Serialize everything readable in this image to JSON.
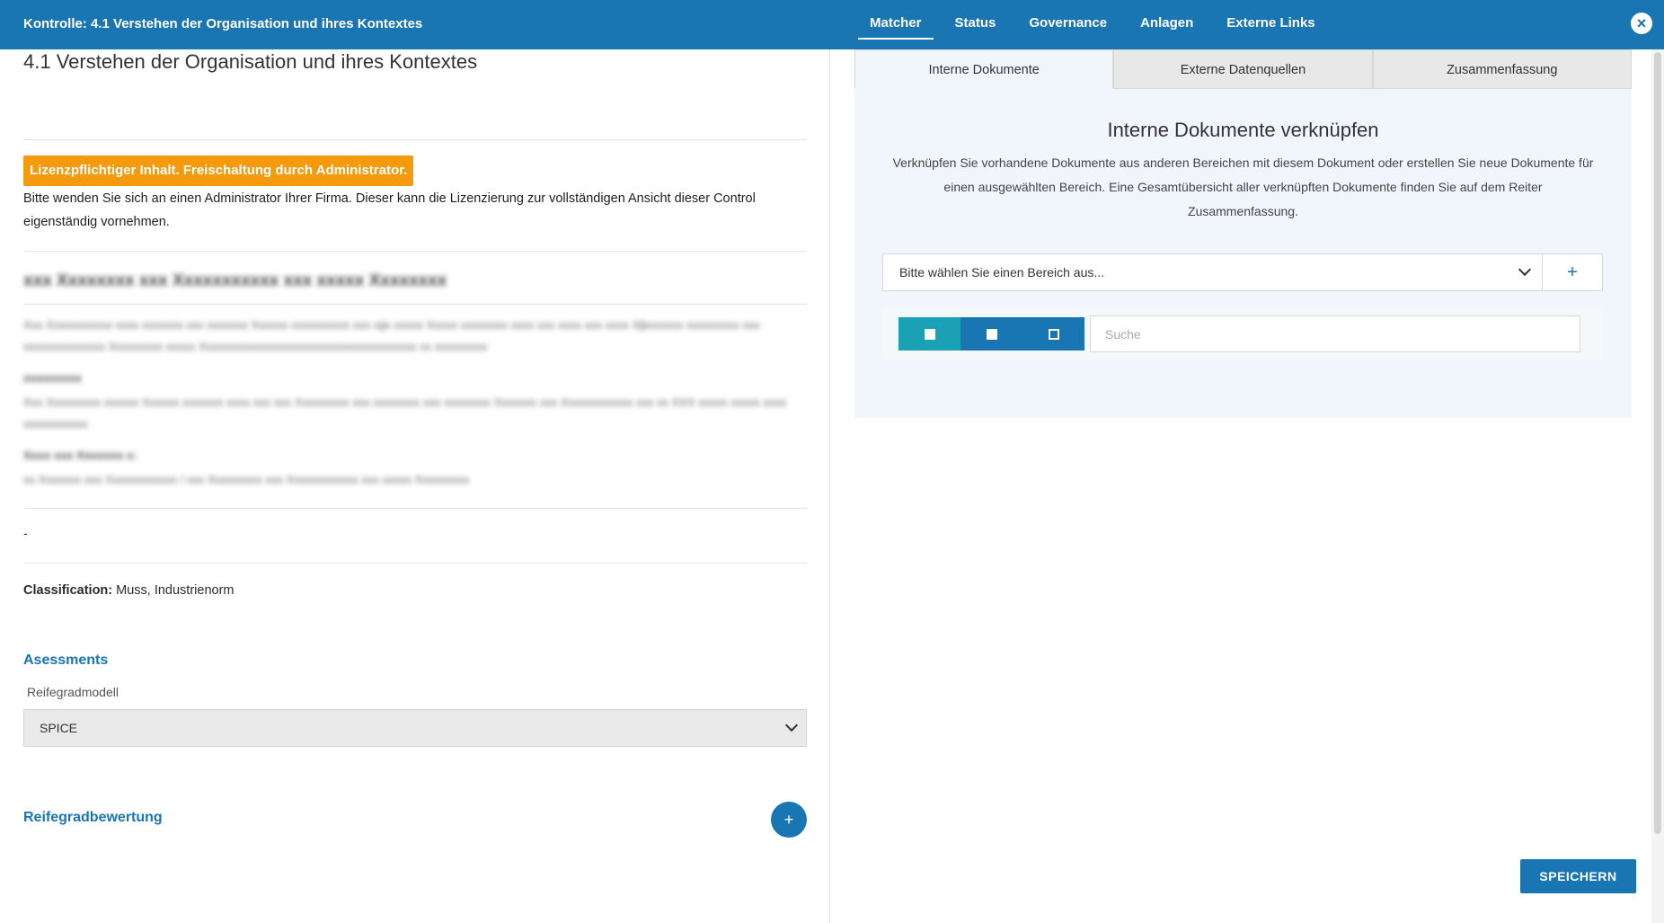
{
  "header": {
    "title": "Kontrolle: 4.1 Verstehen der Organisation und ihres Kontextes",
    "nav": [
      "Matcher",
      "Status",
      "Governance",
      "Anlagen",
      "Externe Links"
    ],
    "close_icon": "close-icon"
  },
  "left": {
    "page_title": "4.1 Verstehen der Organisation und ihres Kontextes",
    "license_badge": "Lizenzpflichtiger Inhalt. Freischaltung durch Administrator.",
    "license_text": "Bitte wenden Sie sich an einen Administrator Ihrer Firma. Dieser kann die Lizenzierung zur vollständigen Ansicht dieser Control eigenständig vornehmen.",
    "blurred": {
      "heading": "xxx Xxxxxxxx xxx Xxxxxxxxxxx xxx xxxxx Xxxxxxxx",
      "p1": "Xxx Xxxxxxxxxxx xxxx xxxxxxx xxx xxxxxxx Xxxxxx xxxxxxxxxx xxx xijx xxxxx Xxxxx xxxxxxxx xxxx xxx xxxx xxx xxxx Xjkxxxxxx xxxxxxxxx xxx xxxxxxxxxxxxxx Xxxxxxxxx xxxxx Xxxxxxxxxxxxxxxxxxxxxxxxxxxxxxxxxxxxx xx xxxxxxxxx",
      "label1": "xxxxxxxxx",
      "p2": "Xxx Xxxxxxxxx xxxxxx Xxxxxx xxxxxxx xxxx xxx xxx Xxxxxxxxx xxx xxxxxxxx xxx xxxxxxxx Xxxxxxx xxx Xxxxxxxxxxxx xxx xx XXX xxxxx xxxxx xxxx xxxxxxxxxxx",
      "label2": "Xxxx xxx Xxxxxxx x:",
      "p3": "xx Xxxxxxx xxx Xxxxxxxxxxxx / xxx Xxxxxxxxx xxx Xxxxxxxxxxxx xxx xxxxx Xxxxxxxxx"
    },
    "dash": "-",
    "classification_label": "Classification:",
    "classification_value": "Muss,  Industrienorm",
    "assessments_title": "Asessments",
    "reifegrad_label": "Reifegradmodell",
    "reifegrad_value": "SPICE",
    "bewertung_title": "Reifegradbewertung",
    "add_label": "+"
  },
  "right": {
    "tabs": [
      "Interne Dokumente",
      "Externe Datenquellen",
      "Zusammenfassung"
    ],
    "title": "Interne Dokumente verknüpfen",
    "description": "Verknüpfen Sie vorhandene Dokumente aus anderen Bereichen mit diesem Dokument oder erstellen Sie neue Dokumente für einen ausgewählten Bereich. Eine Gesamtübersicht aller verknüpften Dokumente finden Sie auf dem Reiter Zusammenfassung.",
    "bereich_placeholder": "Bitte wählen Sie einen Bereich aus...",
    "bereich_add": "+",
    "search_placeholder": "Suche",
    "save_label": "SPEICHERN"
  },
  "colors": {
    "primary": "#1a75b3",
    "accent_teal": "#1aa1b5",
    "warning": "#f59a0c"
  }
}
